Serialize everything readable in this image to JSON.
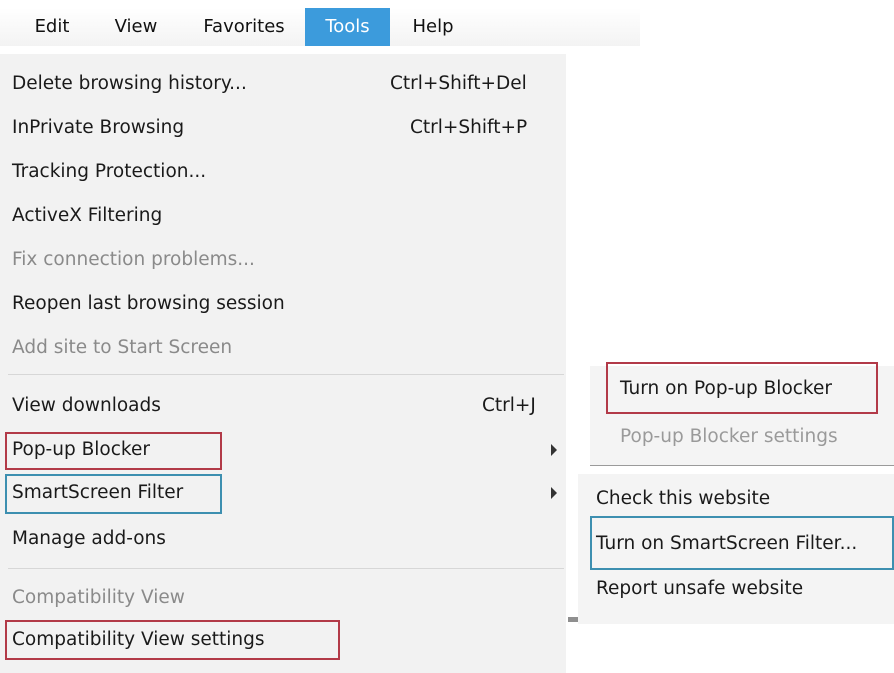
{
  "menubar": {
    "items": [
      {
        "label": "Edit",
        "active": false
      },
      {
        "label": "View",
        "active": false
      },
      {
        "label": "Favorites",
        "active": false
      },
      {
        "label": "Tools",
        "active": true
      },
      {
        "label": "Help",
        "active": false
      }
    ]
  },
  "tools_menu": {
    "items": [
      {
        "label": "Delete browsing history...",
        "shortcut": "Ctrl+Shift+Del",
        "enabled": true
      },
      {
        "label": "InPrivate Browsing",
        "shortcut": "Ctrl+Shift+P",
        "enabled": true
      },
      {
        "label": "Tracking Protection...",
        "enabled": true
      },
      {
        "label": "ActiveX Filtering",
        "enabled": true
      },
      {
        "label": "Fix connection problems...",
        "enabled": false
      },
      {
        "label": "Reopen last browsing session",
        "enabled": true
      },
      {
        "label": "Add site to Start Screen",
        "enabled": false
      },
      {
        "label": "View downloads",
        "shortcut": "Ctrl+J",
        "enabled": true
      },
      {
        "label": "Pop-up Blocker",
        "has_submenu": true,
        "enabled": true
      },
      {
        "label": "SmartScreen Filter",
        "has_submenu": true,
        "enabled": true
      },
      {
        "label": "Manage add-ons",
        "enabled": true
      },
      {
        "label": "Compatibility View",
        "enabled": false
      },
      {
        "label": "Compatibility View settings",
        "enabled": true
      }
    ]
  },
  "popup_blocker_submenu": {
    "items": [
      {
        "label": "Turn on Pop-up Blocker",
        "enabled": true
      },
      {
        "label": "Pop-up Blocker settings",
        "enabled": false
      }
    ]
  },
  "smartscreen_submenu": {
    "items": [
      {
        "label": "Check this website",
        "enabled": true
      },
      {
        "label": "Turn on SmartScreen Filter...",
        "enabled": true
      },
      {
        "label": "Report unsafe website",
        "enabled": true
      }
    ]
  },
  "colors": {
    "active_menu": "#3c9bdc",
    "highlight_red": "#b23a48",
    "highlight_blue": "#3d8fb0",
    "menu_background": "#f2f2f2",
    "disabled_text": "#8a8a8a"
  }
}
